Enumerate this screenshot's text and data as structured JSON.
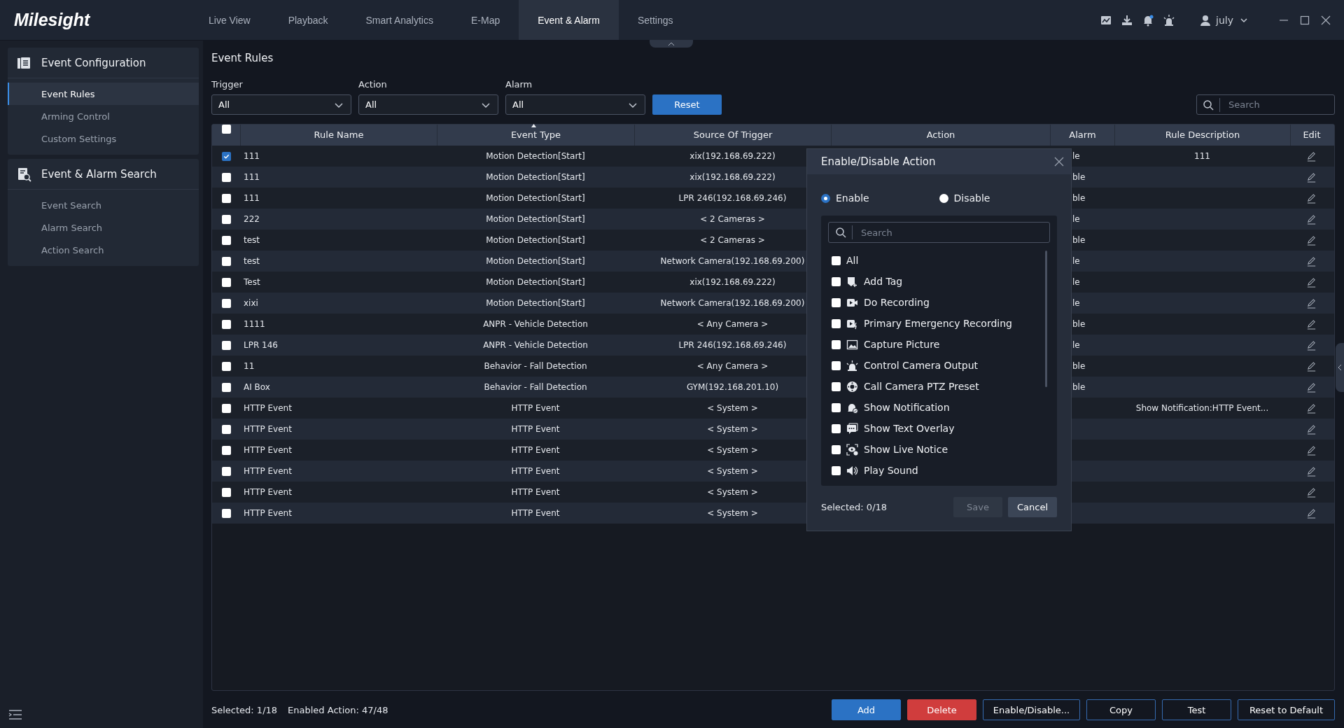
{
  "app": {
    "logo": "Milesight",
    "user": "july"
  },
  "tabs": [
    {
      "label": "Live View",
      "selected": false
    },
    {
      "label": "Playback",
      "selected": false
    },
    {
      "label": "Smart Analytics",
      "selected": false
    },
    {
      "label": "E-Map",
      "selected": false
    },
    {
      "label": "Event & Alarm",
      "selected": true
    },
    {
      "label": "Settings",
      "selected": false
    }
  ],
  "sidebar": {
    "groups": [
      {
        "title": "Event Configuration",
        "kind": "config",
        "items": [
          {
            "label": "Event Rules",
            "selected": true
          },
          {
            "label": "Arming Control",
            "selected": false
          },
          {
            "label": "Custom Settings",
            "selected": false
          }
        ]
      },
      {
        "title": "Event & Alarm Search",
        "kind": "search",
        "items": [
          {
            "label": "Event Search",
            "selected": false
          },
          {
            "label": "Alarm Search",
            "selected": false
          },
          {
            "label": "Action Search",
            "selected": false
          }
        ]
      }
    ]
  },
  "page_title": "Event Rules",
  "filters": [
    {
      "label": "Trigger",
      "value": "All"
    },
    {
      "label": "Action",
      "value": "All"
    },
    {
      "label": "Alarm",
      "value": "All"
    }
  ],
  "reset_button": "Reset",
  "search": {
    "placeholder": "Search"
  },
  "table": {
    "columns": [
      "Rule Name",
      "Event Type",
      "Source Of Trigger",
      "Action",
      "Alarm",
      "Rule Description",
      "Edit"
    ],
    "all_checked": false,
    "rows": [
      {
        "checked": true,
        "rule_name": "111",
        "event_type": "Motion Detection[Start]",
        "source": "xix(192.168.69.222)",
        "alarm": "le",
        "description": "111"
      },
      {
        "checked": false,
        "rule_name": "111",
        "event_type": "Motion Detection[Start]",
        "source": "xix(192.168.69.222)",
        "alarm": "ble"
      },
      {
        "checked": false,
        "rule_name": "111",
        "event_type": "Motion Detection[Start]",
        "source": "LPR 246(192.168.69.246)",
        "alarm": "ble"
      },
      {
        "checked": false,
        "rule_name": "222",
        "event_type": "Motion Detection[Start]",
        "source": "< 2 Cameras >",
        "alarm": "le"
      },
      {
        "checked": false,
        "rule_name": "test",
        "event_type": "Motion Detection[Start]",
        "source": "< 2 Cameras >",
        "alarm": "ble"
      },
      {
        "checked": false,
        "rule_name": "test",
        "event_type": "Motion Detection[Start]",
        "source": "Network Camera(192.168.69.200)",
        "alarm": "le"
      },
      {
        "checked": false,
        "rule_name": "Test",
        "event_type": "Motion Detection[Start]",
        "source": "xix(192.168.69.222)",
        "alarm": "le"
      },
      {
        "checked": false,
        "rule_name": "xixi",
        "event_type": "Motion Detection[Start]",
        "source": "Network Camera(192.168.69.200)",
        "alarm": "le"
      },
      {
        "checked": false,
        "rule_name": "1111",
        "event_type": "ANPR - Vehicle Detection",
        "source": "< Any Camera >",
        "alarm": "ble"
      },
      {
        "checked": false,
        "rule_name": "LPR 146",
        "event_type": "ANPR - Vehicle Detection",
        "source": "LPR 246(192.168.69.246)",
        "alarm": "le"
      },
      {
        "checked": false,
        "rule_name": "11",
        "event_type": "Behavior - Fall Detection",
        "source": "< Any Camera >",
        "alarm": "ble"
      },
      {
        "checked": false,
        "rule_name": "AI Box",
        "event_type": "Behavior - Fall Detection",
        "source": "GYM(192.168.201.10)",
        "alarm": "ble"
      },
      {
        "checked": false,
        "rule_name": "HTTP Event",
        "event_type": "HTTP Event",
        "source": "< System >",
        "description": "Show Notification:HTTP Event..."
      },
      {
        "checked": false,
        "rule_name": "HTTP Event",
        "event_type": "HTTP Event",
        "source": "< System >"
      },
      {
        "checked": false,
        "rule_name": "HTTP Event",
        "event_type": "HTTP Event",
        "source": "< System >"
      },
      {
        "checked": false,
        "rule_name": "HTTP Event",
        "event_type": "HTTP Event",
        "source": "< System >"
      },
      {
        "checked": false,
        "rule_name": "HTTP Event",
        "event_type": "HTTP Event",
        "source": "< System >"
      },
      {
        "checked": false,
        "rule_name": "HTTP Event",
        "event_type": "HTTP Event",
        "source": "< System >"
      }
    ]
  },
  "status": {
    "selected": "Selected: 1/18",
    "enabled": "Enabled Action: 47/48"
  },
  "buttons": [
    {
      "label": "Add",
      "kind": "primary"
    },
    {
      "label": "Delete",
      "kind": "danger"
    },
    {
      "label": "Enable/Disable...",
      "kind": "outline"
    },
    {
      "label": "Copy",
      "kind": "outline"
    },
    {
      "label": "Test",
      "kind": "outline"
    },
    {
      "label": "Reset to Default",
      "kind": "outline"
    }
  ],
  "dialog": {
    "title": "Enable/Disable Action",
    "modes": [
      {
        "label": "Enable",
        "selected": true
      },
      {
        "label": "Disable",
        "selected": false
      }
    ],
    "search": {
      "placeholder": "Search"
    },
    "options": [
      {
        "label": "All",
        "kind": "all",
        "checked": false
      },
      {
        "label": "Add Tag",
        "kind": "tag",
        "checked": false
      },
      {
        "label": "Do Recording",
        "kind": "recording",
        "checked": false
      },
      {
        "label": "Primary Emergency Recording",
        "kind": "emergency",
        "checked": false
      },
      {
        "label": "Capture Picture",
        "kind": "picture",
        "checked": false
      },
      {
        "label": "Control Camera Output",
        "kind": "output",
        "checked": false
      },
      {
        "label": "Call Camera PTZ Preset",
        "kind": "ptz",
        "checked": false
      },
      {
        "label": "Show Notification",
        "kind": "notification",
        "checked": false
      },
      {
        "label": "Show Text Overlay",
        "kind": "overlay",
        "checked": false
      },
      {
        "label": "Show Live Notice",
        "kind": "live",
        "checked": false
      },
      {
        "label": "Play Sound",
        "kind": "sound",
        "checked": false
      }
    ],
    "selected_count": "Selected: 0/18",
    "save": {
      "label": "Save",
      "disabled": true
    },
    "cancel": "Cancel"
  }
}
